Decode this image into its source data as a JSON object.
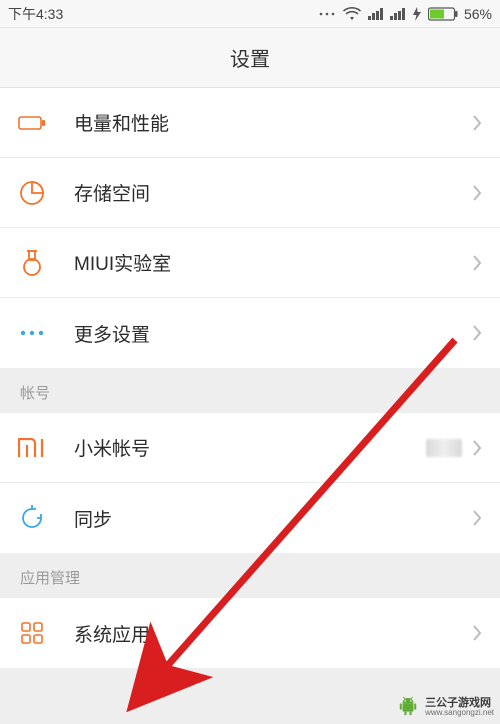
{
  "status": {
    "time": "下午4:33",
    "battery_pct": "56%"
  },
  "header": {
    "title": "设置"
  },
  "groups": [
    {
      "key": "g1",
      "items": [
        {
          "key": "battery",
          "icon": "battery-perf-icon",
          "label": "电量和性能"
        },
        {
          "key": "storage",
          "icon": "storage-icon",
          "label": "存储空间"
        },
        {
          "key": "miui_lab",
          "icon": "lab-flask-icon",
          "label": "MIUI实验室"
        },
        {
          "key": "more",
          "icon": "more-dots-icon",
          "label": "更多设置"
        }
      ]
    },
    {
      "key": "g2",
      "header": "帐号",
      "items": [
        {
          "key": "mi_account",
          "icon": "mi-logo-icon",
          "label": "小米帐号",
          "has_value": true
        },
        {
          "key": "sync",
          "icon": "sync-icon",
          "label": "同步"
        }
      ]
    },
    {
      "key": "g3",
      "header": "应用管理",
      "items": [
        {
          "key": "system_apps",
          "icon": "grid-apps-icon",
          "label": "系统应用"
        }
      ]
    }
  ],
  "colors": {
    "accent_orange": "#f2732c",
    "accent_blue": "#3aa7e6",
    "battery_green": "#6ecb2e",
    "arrow_red": "#d81e1e"
  },
  "watermark": {
    "cn": "三公子游戏网",
    "url": "www.sangongzi.net"
  }
}
